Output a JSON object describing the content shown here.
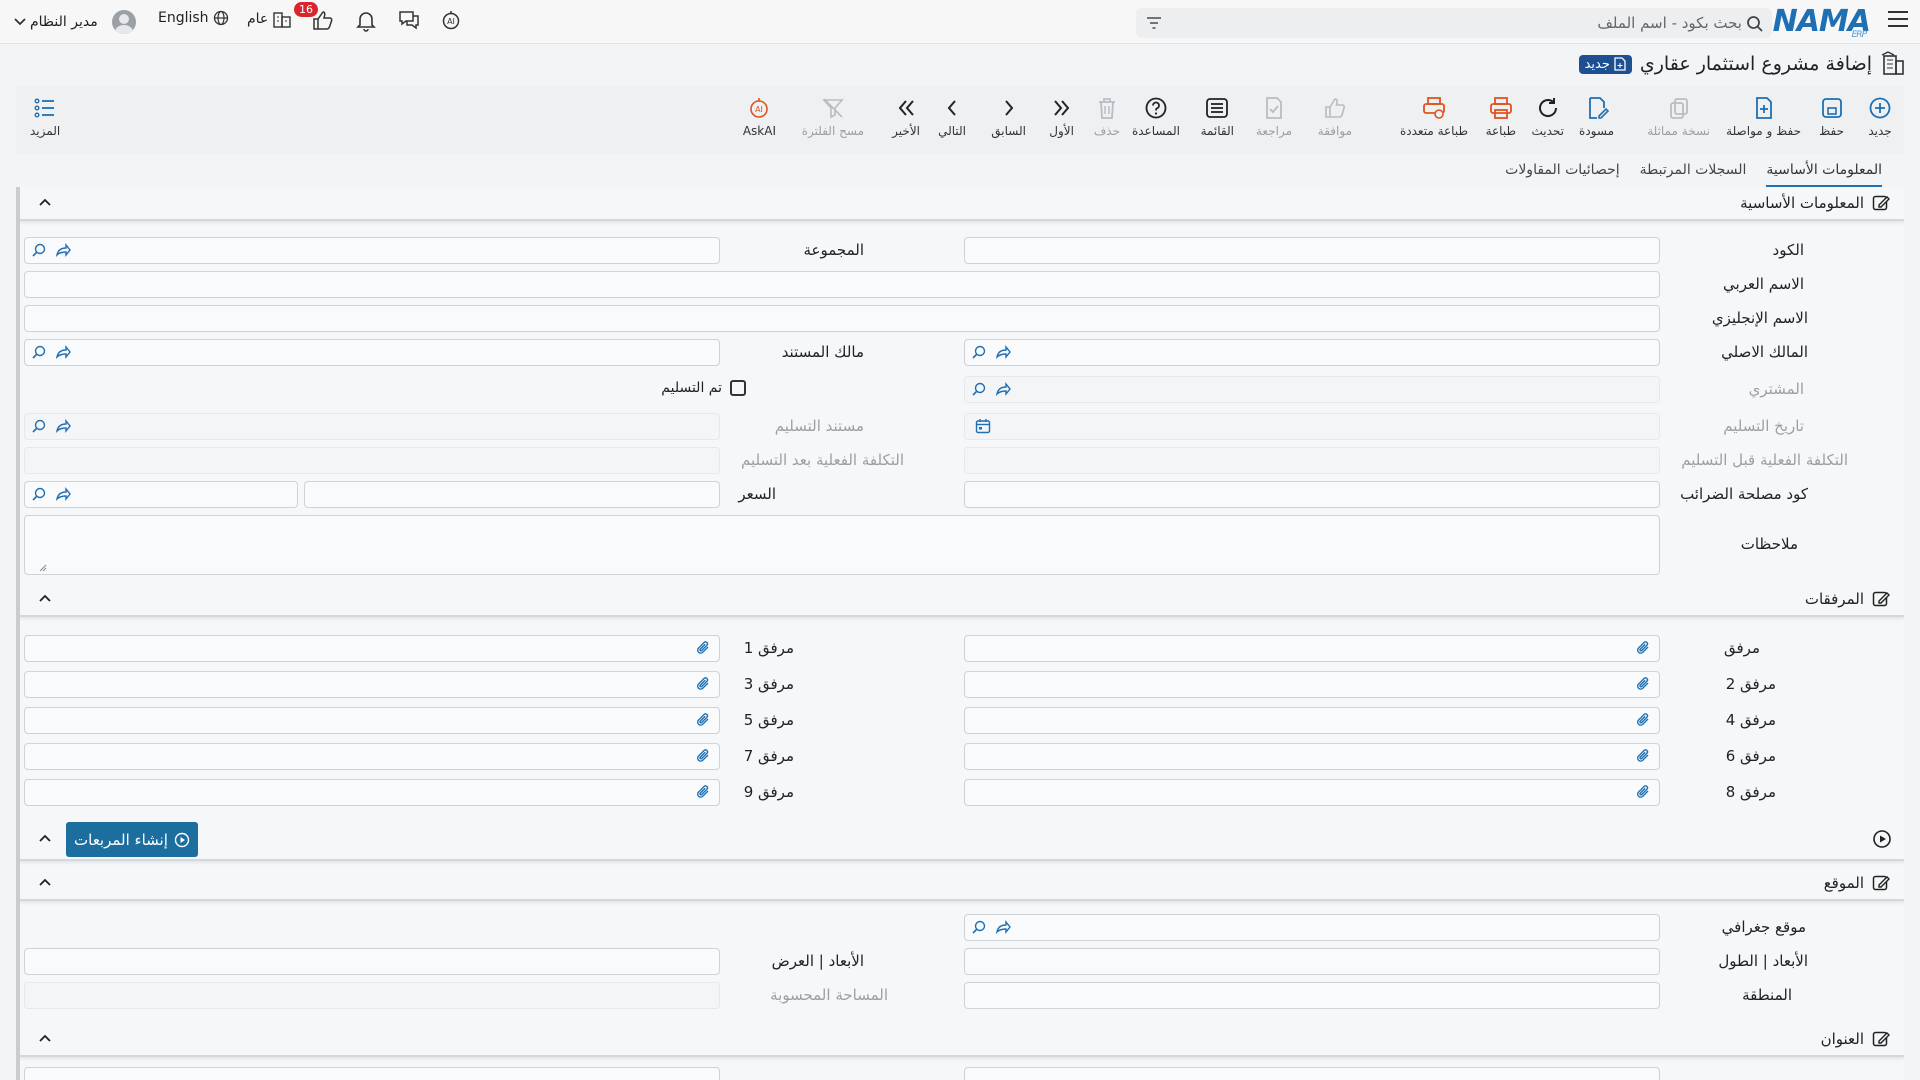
{
  "header": {
    "logo": "NAMA",
    "logo_sub": "ERP",
    "search_placeholder": "بحث بكود - اسم الملف",
    "language": "English",
    "scope": "عام",
    "notif_count": "16",
    "user": "مدير النظام"
  },
  "page": {
    "title": "إضافة مشروع استثمار عقاري",
    "badge": "جديد"
  },
  "toolbar": {
    "new": "جديد",
    "save": "حفظ",
    "save_continue": "حفظ و مواصلة",
    "copy": "نسخة مماثلة",
    "draft": "مسودة",
    "refresh": "تحديث",
    "print": "طباعة",
    "multi_print": "طباعة متعددة",
    "approve": "موافقة",
    "review": "مراجعة",
    "list": "القائمة",
    "help": "المساعدة",
    "delete": "حذف",
    "first": "الأول",
    "prev": "السابق",
    "next": "التالي",
    "last": "الأخير",
    "clear_filter": "مسح الفلترة",
    "askai": "AskAI",
    "more": "المزيد"
  },
  "tabs": [
    "المعلومات الأساسية",
    "السجلات المرتبطة",
    "إحصائيات المقاولات"
  ],
  "basic": {
    "title": "المعلومات الأساسية",
    "code": "الكود",
    "group": "المجموعة",
    "arabic_name": "الاسم العربي",
    "english_name": "الاسم الإنجليزي",
    "original_owner": "المالك الاصلي",
    "doc_owner": "مالك المستند",
    "buyer": "المشتري",
    "delivered": "تم التسليم",
    "delivery_date": "تاريخ التسليم",
    "delivery_doc": "مستند التسليم",
    "cost_before": "التكلفة الفعلية قبل التسليم",
    "cost_after": "التكلفة الفعلية بعد التسليم",
    "tax_code": "كود مصلحة الضرائب",
    "price": "السعر",
    "notes": "ملاحظات"
  },
  "attachments": {
    "title": "المرفقات",
    "a0": "مرفق",
    "a1": "مرفق 1",
    "a2": "مرفق 2",
    "a3": "مرفق 3",
    "a4": "مرفق 4",
    "a5": "مرفق 5",
    "a6": "مرفق 6",
    "a7": "مرفق 7",
    "a8": "مرفق 8",
    "a9": "مرفق 9"
  },
  "generate_button": "إنشاء المربعات",
  "location": {
    "title": "الموقع",
    "geo": "موقع جغرافي",
    "length": "الأبعاد | الطول",
    "width": "الأبعاد | العرض",
    "area": "المنطقة",
    "calc_area": "المساحة المحسوبة"
  },
  "address": {
    "title": "العنوان"
  },
  "colors": {
    "brand": "#1f6fb3",
    "accent": "#1b6e9e",
    "badge": "#d9262c",
    "print": "#e0531f"
  }
}
